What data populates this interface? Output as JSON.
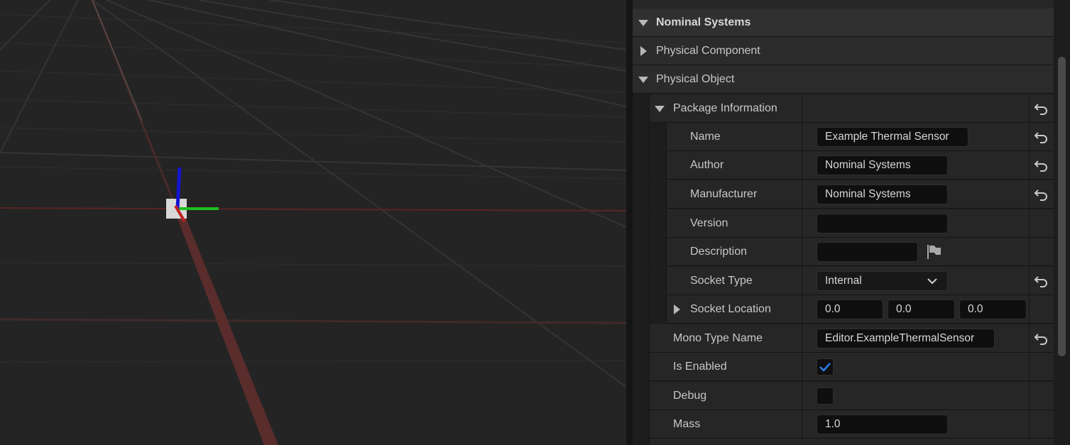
{
  "viewport": {
    "background": "#242424",
    "gizmo": {
      "x_axis_color": "#c02020",
      "y_axis_color": "#1fbf1f",
      "z_axis_color": "#1414d0"
    }
  },
  "details": {
    "root_category": "Nominal Systems",
    "categories": [
      {
        "label": "Physical Component",
        "expanded": false
      },
      {
        "label": "Physical Object",
        "expanded": true
      }
    ],
    "package_information": {
      "label": "Package Information",
      "fields": {
        "name": {
          "label": "Name",
          "value": "Example Thermal Sensor"
        },
        "author": {
          "label": "Author",
          "value": "Nominal Systems"
        },
        "manufacturer": {
          "label": "Manufacturer",
          "value": "Nominal Systems"
        },
        "version": {
          "label": "Version",
          "value": ""
        },
        "description": {
          "label": "Description",
          "value": "",
          "icon": "flag-icon"
        },
        "socket_type": {
          "label": "Socket Type",
          "value": "Internal",
          "icon": "chevron-down-icon"
        },
        "socket_location": {
          "label": "Socket Location",
          "x": "0.0",
          "y": "0.0",
          "z": "0.0"
        }
      }
    },
    "mono_type_name": {
      "label": "Mono Type Name",
      "value": "Editor.ExampleThermalSensor"
    },
    "is_enabled": {
      "label": "Is Enabled",
      "checked": true
    },
    "debug": {
      "label": "Debug",
      "checked": false
    },
    "mass": {
      "label": "Mass",
      "value": "1.0"
    },
    "reset_icon": "reset-arrow-icon",
    "accent_color": "#2a7fe6"
  }
}
